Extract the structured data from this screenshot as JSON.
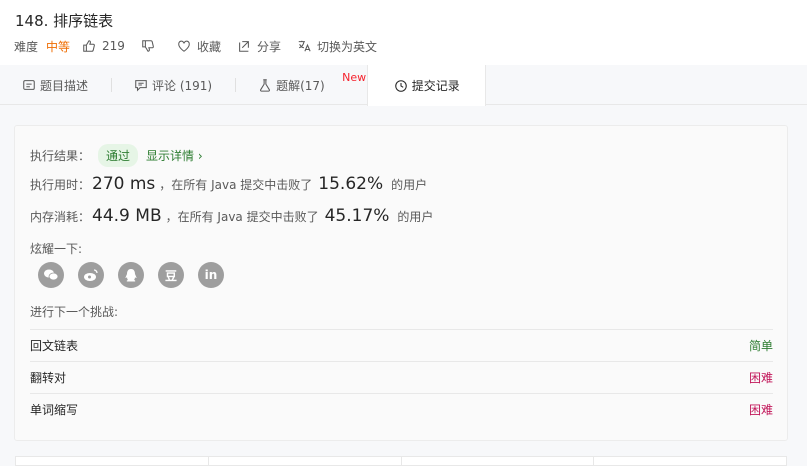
{
  "header": {
    "title": "148. 排序链表",
    "difficulty_label": "难度",
    "difficulty_value": "中等",
    "likes": "219",
    "favorite_label": "收藏",
    "share_label": "分享",
    "switch_lang_label": "切换为英文"
  },
  "tabs": [
    {
      "label": "题目描述",
      "icon": "description-icon"
    },
    {
      "label": "评论 (191)",
      "icon": "comment-icon"
    },
    {
      "label": "题解(17)",
      "icon": "flask-icon",
      "badge": "New"
    },
    {
      "label": "提交记录",
      "icon": "clock-icon"
    }
  ],
  "result": {
    "result_label": "执行结果：",
    "status": "通过",
    "detail_link": "显示详情 ›",
    "time_label": "执行用时：",
    "time_value": "270 ms",
    "time_mid": "，在所有 Java 提交中击败了",
    "time_percent": "15.62%",
    "users_suffix": "的用户",
    "mem_label": "内存消耗：",
    "mem_value": "44.9 MB",
    "mem_mid": "，在所有 Java 提交中击败了",
    "mem_percent": "45.17%",
    "show_off_label": "炫耀一下:",
    "next_label": "进行下一个挑战:"
  },
  "share_icons": [
    "wechat-icon",
    "weibo-icon",
    "qq-icon",
    "douban-icon",
    "linkedin-icon"
  ],
  "share_glyphs": {
    "douban": "豆",
    "linkedin": "in"
  },
  "challenges": [
    {
      "name": "回文链表",
      "level": "简单"
    },
    {
      "name": "翻转对",
      "level": "困难"
    },
    {
      "name": "单词缩写",
      "level": "困难"
    }
  ],
  "colors": {
    "accent_green": "#2e7d32",
    "medium_orange": "#ef6c00",
    "hard_red": "#c2185b",
    "new_badge": "#f5222d"
  }
}
